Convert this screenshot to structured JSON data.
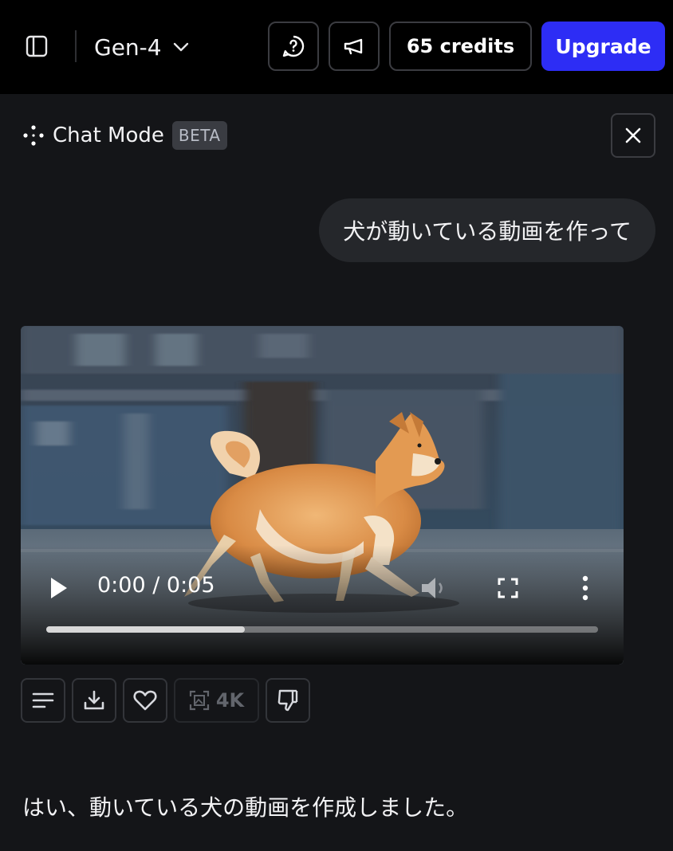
{
  "header": {
    "model_name": "Gen-4",
    "credits_label": "65 credits",
    "upgrade_label": "Upgrade"
  },
  "chat": {
    "title": "Chat Mode",
    "badge": "BETA",
    "user_message": "犬が動いている動画を作って",
    "assistant_reply": "はい、動いている犬の動画を作成しました。"
  },
  "video": {
    "time_display": "0:00 / 0:05",
    "progress_fraction": 0.36
  },
  "actions": {
    "upscale_label": "4K"
  },
  "colors": {
    "accent": "#2d2df5",
    "background": "#141518",
    "topbar": "#000000",
    "bubble": "#25272b",
    "border": "#3b3c41"
  },
  "icons": [
    "sidebar-toggle-icon",
    "chevron-down-icon",
    "feedback-chat-icon",
    "megaphone-icon",
    "sparkle-dots-icon",
    "close-icon",
    "play-icon",
    "volume-icon",
    "fullscreen-icon",
    "more-vertical-icon",
    "text-lines-icon",
    "download-icon",
    "heart-icon",
    "upscale-icon",
    "thumbs-down-icon"
  ]
}
